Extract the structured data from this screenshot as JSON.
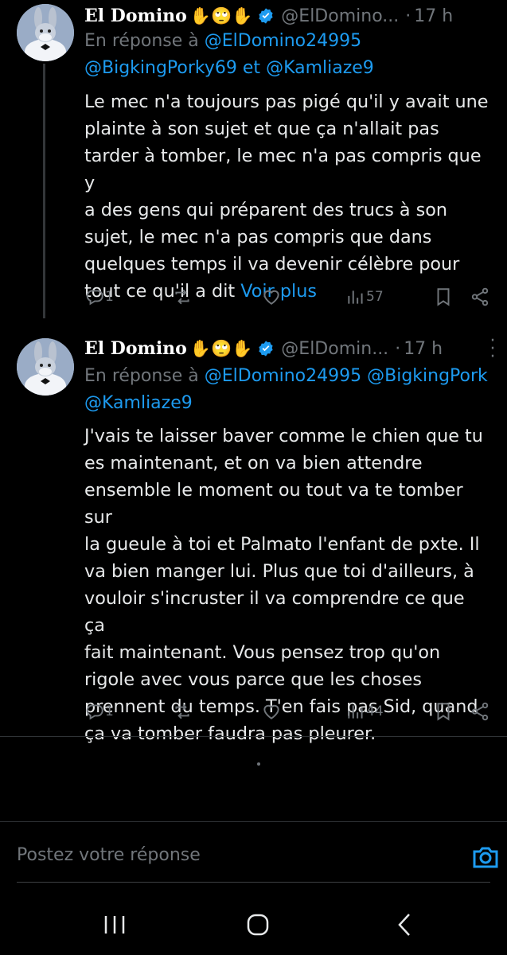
{
  "tweets": [
    {
      "name": "El Domino",
      "emojis": "✋🙄✋",
      "handle": "@ElDomino...",
      "time": "17 h",
      "reply_prefix": "En réponse à",
      "reply_line1": "@ElDomino24995",
      "reply_line2_a": "@BigkingPorky69",
      "reply_line2_and": "et",
      "reply_line2_b": "@Kamliaze9",
      "lines": [
        "Le mec n'a toujours pas pigé qu'il y avait une",
        "plainte à son sujet et que ça n'allait pas",
        "tarder à tomber, le mec n'a pas compris que y",
        "a des gens qui préparent des trucs à son",
        "sujet, le mec n'a pas compris que dans",
        "quelques temps il va devenir célèbre pour",
        "tout ce qu'il a dit"
      ],
      "see_more": "Voir plus",
      "replies": "1",
      "views": "57"
    },
    {
      "name": "El Domino",
      "emojis": "✋🙄✋",
      "handle": "@ElDomin...",
      "time": "17 h",
      "reply_prefix": "En réponse à",
      "reply_line1": "@ElDomino24995 @BigkingPork",
      "reply_line2": "@Kamliaze9",
      "lines": [
        "J'vais te laisser baver comme le chien que tu",
        "es maintenant, et on va bien attendre",
        "ensemble le moment ou tout va te tomber sur",
        "la gueule à toi et Palmato l'enfant de pxte. Il",
        "va bien manger lui. Plus que toi d'ailleurs, à",
        "vouloir s'incruster il va comprendre ce que ça",
        "fait maintenant. Vous pensez trop qu'on",
        "rigole avec vous parce que les choses",
        "prennent du temps. T'en fais pas Sid, quand",
        "ça va tomber faudra pas pleurer."
      ],
      "replies": "1",
      "views": "44"
    }
  ],
  "compose": {
    "placeholder": "Postez votre réponse"
  },
  "icons": {
    "reply": "reply-icon",
    "retweet": "retweet-icon",
    "like": "like-icon",
    "views": "views-icon",
    "bookmark": "bookmark-icon",
    "share": "share-icon",
    "camera": "camera-icon",
    "verified": "verified-badge-icon",
    "nav_recents": "recents-icon",
    "nav_home": "home-icon",
    "nav_back": "back-icon"
  },
  "colors": {
    "background": "#000000",
    "accent": "#1d9bf0",
    "muted": "#71767b",
    "text": "#e7e9ea"
  }
}
